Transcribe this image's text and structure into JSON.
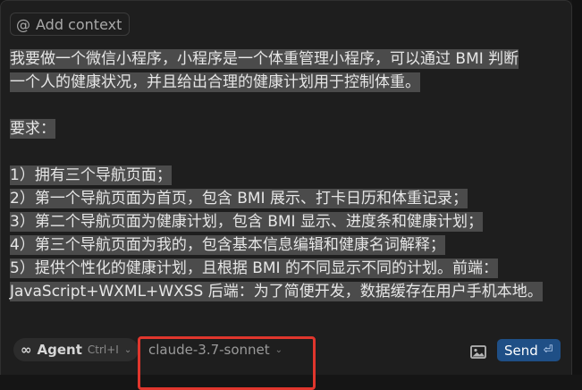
{
  "composer": {
    "add_context_label": "Add context",
    "prompt_lines": [
      "我要做一个微信小程序，小程序是一个体重管理小程序，可以通过 BMI 判断",
      "一个人的健康状况，并且给出合理的健康计划用于控制体重。",
      "",
      "要求：",
      "",
      "1）拥有三个导航页面；",
      "2）第一个导航页面为首页，包含 BMI 展示、打卡日历和体重记录；",
      "3）第二个导航页面为健康计划，包含 BMI 显示、进度条和健康计划；",
      "4）第三个导航页面为我的，包含基本信息编辑和健康名词解释；",
      "5）提供个性化的健康计划，且根据 BMI 的不同显示不同的计划。前端：",
      "JavaScript+WXML+WXSS 后端：为了简便开发，数据缓存在用户手机本地。"
    ]
  },
  "toolbar": {
    "mode_label": "Agent",
    "mode_shortcut": "Ctrl+I",
    "model_label": "claude-3.7-sonnet",
    "send_label": "Send"
  },
  "icons": {
    "at": "at-icon",
    "infinity": "infinity-icon",
    "image": "image-icon",
    "enter": "enter-icon"
  },
  "colors": {
    "background": "#1e1e1e",
    "selection": "#4b4b4b",
    "send_button": "#1f4f86",
    "highlight_box": "#e0362d"
  }
}
